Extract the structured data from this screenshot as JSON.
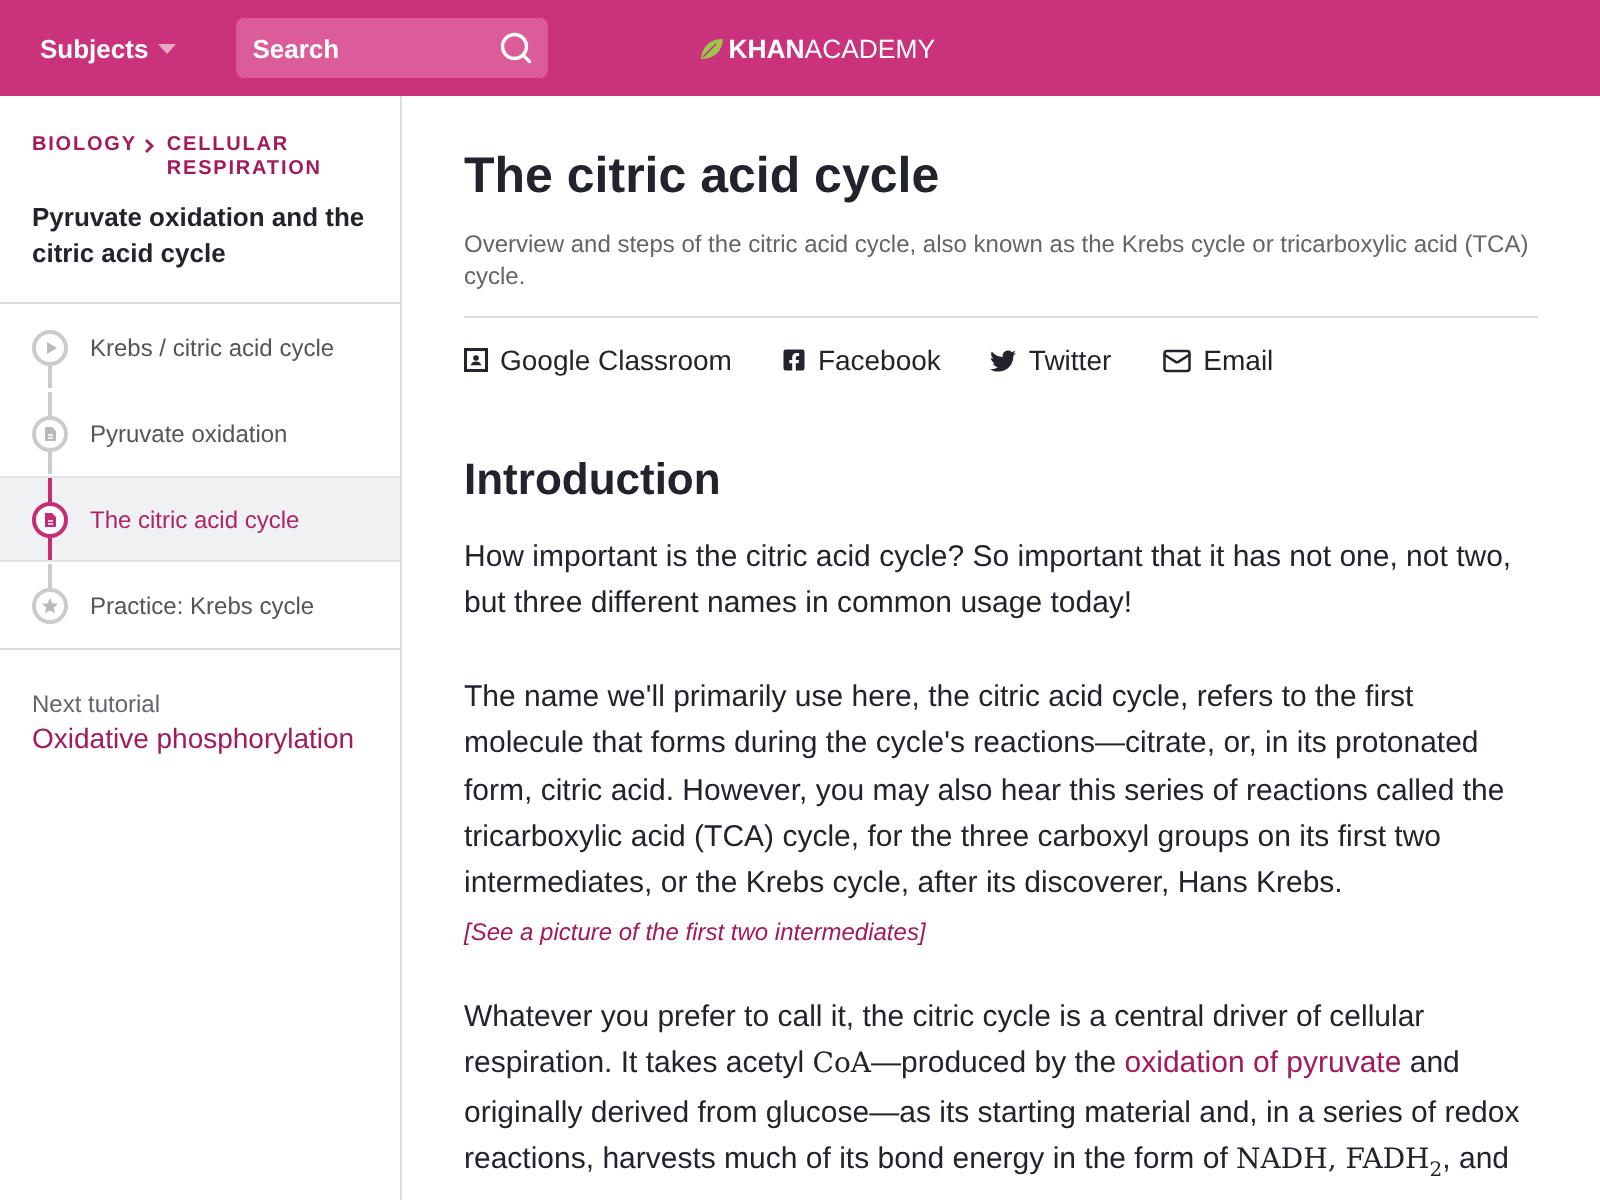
{
  "header": {
    "subjects": "Subjects",
    "search": {
      "placeholder": "Search"
    },
    "logo": "**KHAN**ACADEMY"
  },
  "sidebar": {
    "breadcrumb": [
      "BIOLOGY",
      "CELLULAR RESPIRATION"
    ],
    "title": "Pyruvate oxidation and the citric acid cycle",
    "items": [
      {
        "kind": "video",
        "label": "Krebs / citric acid cycle",
        "selected": false
      },
      {
        "kind": "article",
        "label": "Pyruvate oxidation",
        "selected": false
      },
      {
        "kind": "article",
        "label": "The citric acid cycle",
        "selected": true
      },
      {
        "kind": "exercise",
        "label": "Practice: Krebs cycle",
        "selected": false
      }
    ],
    "next": {
      "label": "Next tutorial",
      "link": "Oxidative phosphorylation"
    }
  },
  "article": {
    "title": "The citric acid cycle",
    "subtitle": "Overview and steps of the citric acid cycle, also known as the Krebs cycle or tricarboxylic acid (TCA) cycle.",
    "share": [
      {
        "kind": "classroom",
        "label": "Google Classroom"
      },
      {
        "kind": "facebook",
        "label": "Facebook"
      },
      {
        "kind": "twitter",
        "label": "Twitter"
      },
      {
        "kind": "email",
        "label": "Email"
      }
    ],
    "heading": "Introduction",
    "blocks": [
      {
        "kind": "paragraph",
        "segments": [
          {
            "kind": "text",
            "text": "How important is the citric acid cycle? So important that it has not one, not two, but three different names in common usage today!"
          }
        ]
      },
      {
        "kind": "paragraph",
        "segments": [
          {
            "kind": "text",
            "text": "The name we'll primarily use here, the citric acid cycle, refers to the first molecule that forms during the cycle's reactions—citrate, or, in its protonated form, citric acid. However, you may also hear this series of reactions called the tricarboxylic acid (TCA) cycle, for the three carboxyl groups on its first two intermediates, or the Krebs cycle, after its discoverer, Hans Krebs."
          }
        ]
      },
      {
        "kind": "link",
        "text": "[See a picture of the first two intermediates]"
      },
      {
        "kind": "paragraph",
        "segments": [
          {
            "kind": "text",
            "text": "Whatever you prefer to call it, the citric cycle is a central driver of cellular respiration. It takes acetyl "
          },
          {
            "kind": "math",
            "text": "CoA"
          },
          {
            "kind": "text",
            "text": "—produced by the "
          },
          {
            "kind": "link",
            "text": "oxidation of pyruvate"
          },
          {
            "kind": "text",
            "text": " and originally derived from glucose—as its starting material and, in a series of redox reactions, harvests much of its bond energy in the form of "
          },
          {
            "kind": "math",
            "text": "NADH, FADH$_{2}$"
          },
          {
            "kind": "text",
            "text": ", and"
          }
        ]
      }
    ]
  }
}
